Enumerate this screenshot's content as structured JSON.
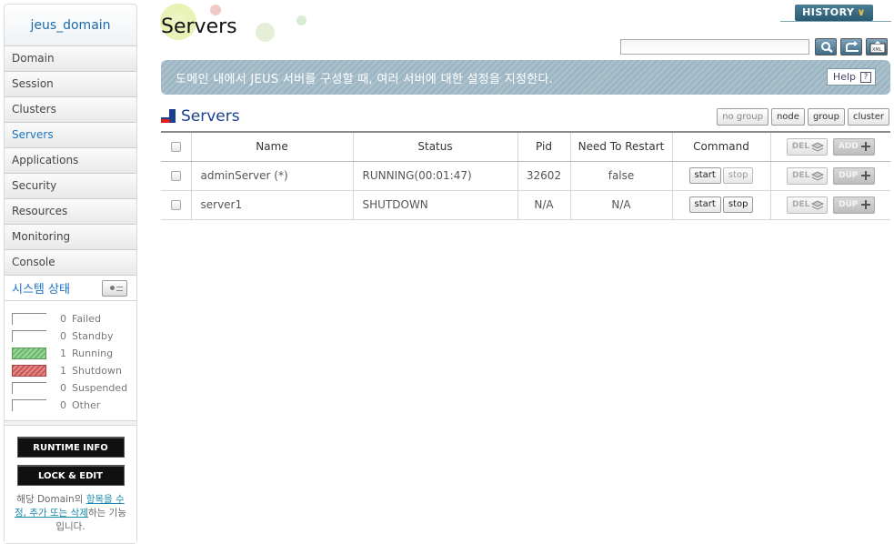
{
  "sidebar": {
    "domain": "jeus_domain",
    "items": [
      {
        "label": "Domain",
        "active": false
      },
      {
        "label": "Session",
        "active": false
      },
      {
        "label": "Clusters",
        "active": false
      },
      {
        "label": "Servers",
        "active": true
      },
      {
        "label": "Applications",
        "active": false
      },
      {
        "label": "Security",
        "active": false
      },
      {
        "label": "Resources",
        "active": false
      },
      {
        "label": "Monitoring",
        "active": false
      },
      {
        "label": "Console",
        "active": false
      }
    ],
    "system_status": {
      "title": "시스템 상태",
      "rows": [
        {
          "count": "0",
          "label": "Failed"
        },
        {
          "count": "0",
          "label": "Standby"
        },
        {
          "count": "1",
          "label": "Running"
        },
        {
          "count": "1",
          "label": "Shutdown"
        },
        {
          "count": "0",
          "label": "Suspended"
        },
        {
          "count": "0",
          "label": "Other"
        }
      ]
    },
    "runtime_info": "RUNTIME INFO",
    "lock_edit": "LOCK & EDIT",
    "note_prefix": "해당 Domain의 ",
    "note_link": "항목을 수정, 추가 또는 삭제",
    "note_suffix": "하는 기능입니다."
  },
  "header": {
    "title": "Servers",
    "history": "HISTORY",
    "search_value": ""
  },
  "banner": {
    "text": "도메인 내에서 JEUS 서버를 구성할 때, 여러 서버에 대한 설정을 지정한다.",
    "help": "Help",
    "help_q": "?"
  },
  "section": {
    "title": "Servers",
    "group_buttons": [
      "no group",
      "node",
      "group",
      "cluster"
    ]
  },
  "table": {
    "columns": [
      "Name",
      "Status",
      "Pid",
      "Need To Restart",
      "Command"
    ],
    "header_del": "DEL",
    "header_add": "ADD",
    "row_del": "DEL",
    "row_dup": "DUP",
    "start": "start",
    "stop": "stop",
    "rows": [
      {
        "name": "adminServer (*)",
        "status": "RUNNING(00:01:47)",
        "pid": "32602",
        "restart": "false"
      },
      {
        "name": "server1",
        "status": "SHUTDOWN",
        "pid": "N/A",
        "restart": "N/A"
      }
    ]
  },
  "colors": {
    "accent": "#1a73c4",
    "banner": "#a3bac7",
    "history": "#2b5a70",
    "running": "#6cb86c",
    "shutdown": "#cc5555"
  }
}
